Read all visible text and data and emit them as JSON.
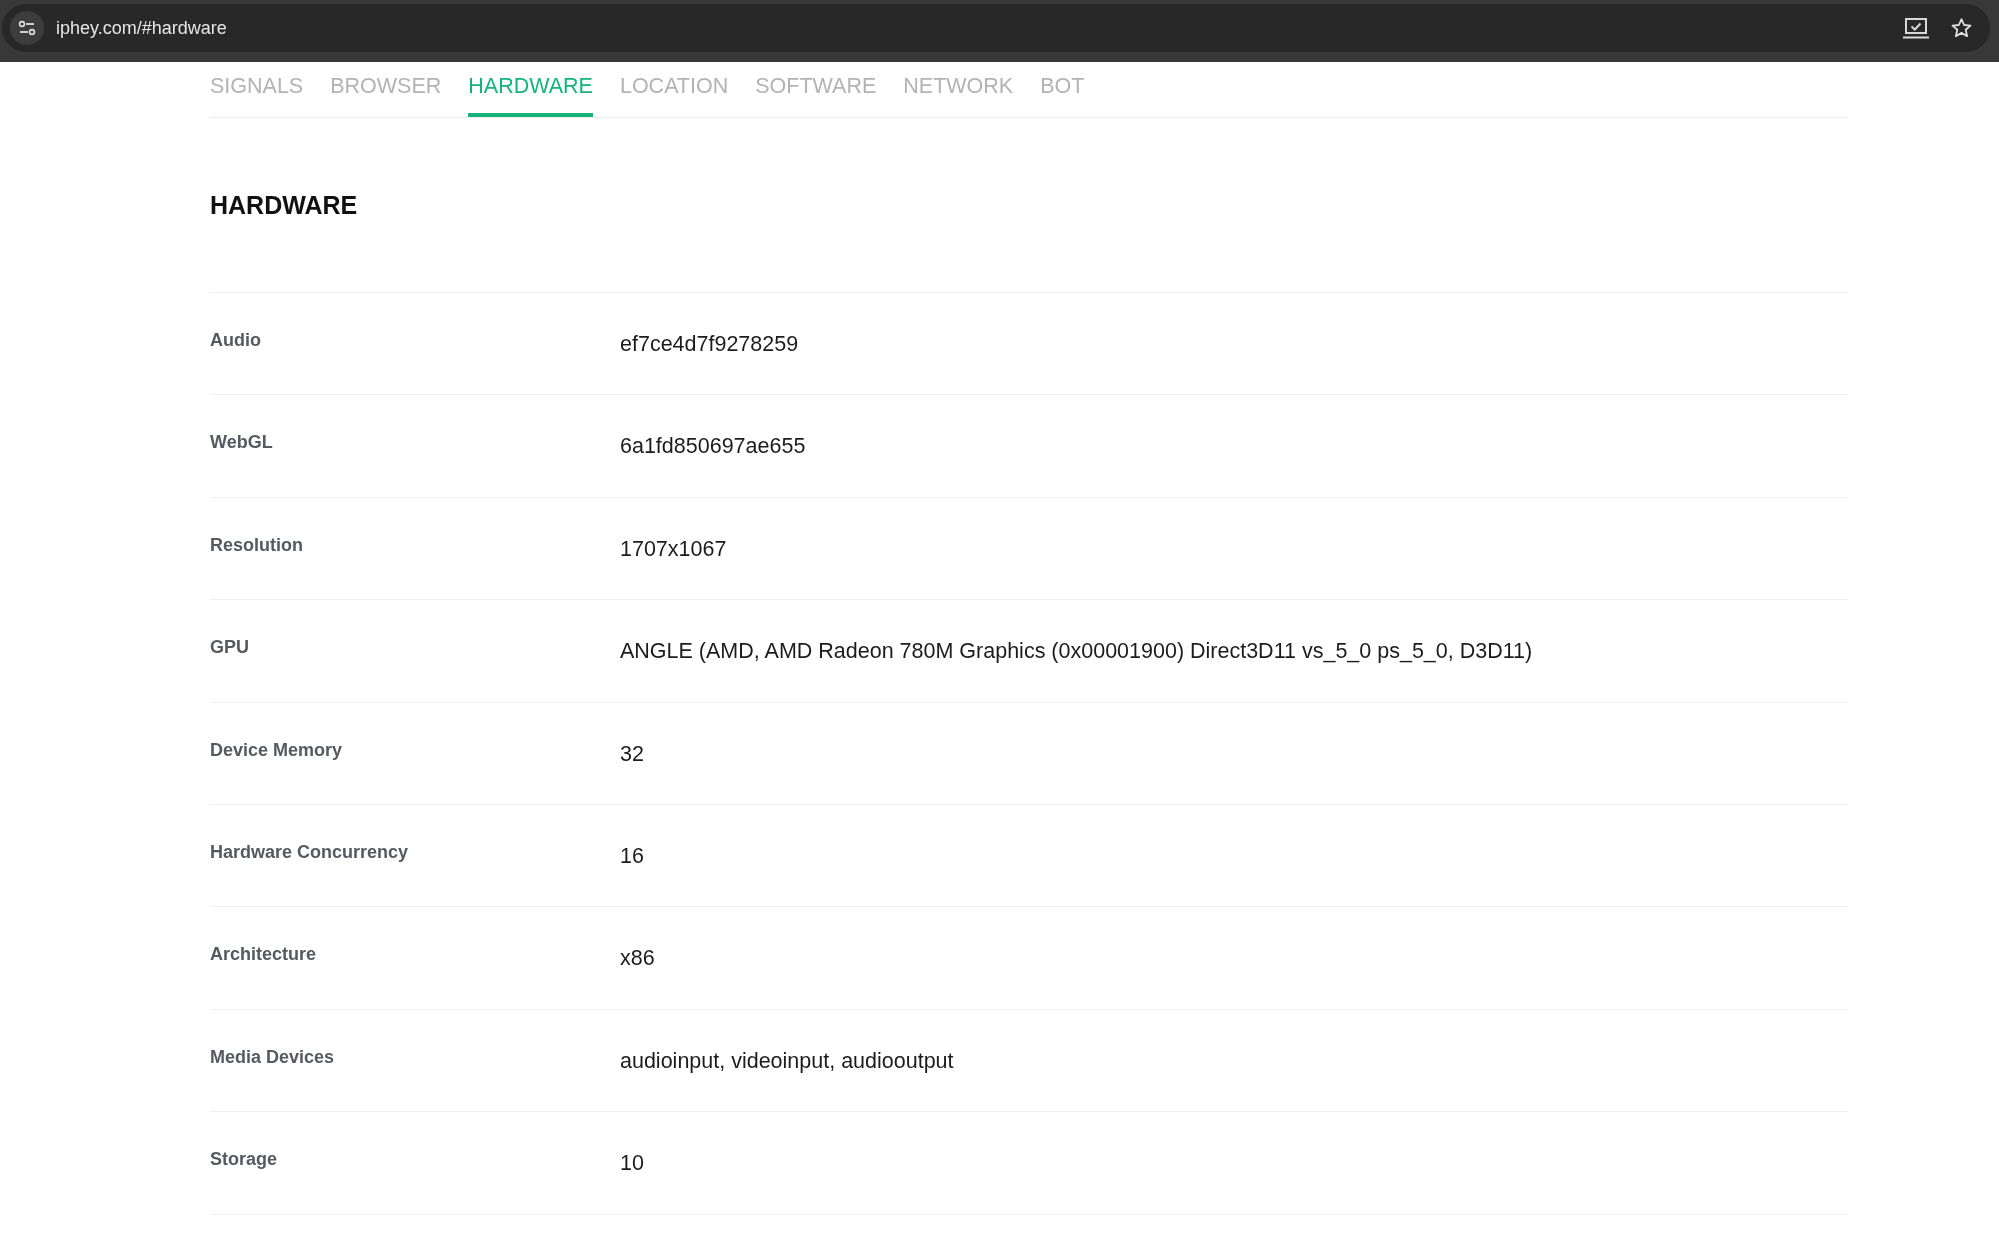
{
  "browser": {
    "url": "iphey.com/#hardware"
  },
  "tabs": [
    {
      "label": "SIGNALS",
      "selected": false
    },
    {
      "label": "BROWSER",
      "selected": false
    },
    {
      "label": "HARDWARE",
      "selected": true
    },
    {
      "label": "LOCATION",
      "selected": false
    },
    {
      "label": "SOFTWARE",
      "selected": false
    },
    {
      "label": "NETWORK",
      "selected": false
    },
    {
      "label": "BOT",
      "selected": false
    }
  ],
  "section": {
    "title": "HARDWARE",
    "rows": [
      {
        "label": "Audio",
        "value": "ef7ce4d7f9278259"
      },
      {
        "label": "WebGL",
        "value": "6a1fd850697ae655"
      },
      {
        "label": "Resolution",
        "value": "1707x1067"
      },
      {
        "label": "GPU",
        "value": "ANGLE (AMD, AMD Radeon 780M Graphics (0x00001900) Direct3D11 vs_5_0 ps_5_0, D3D11)"
      },
      {
        "label": "Device Memory",
        "value": "32"
      },
      {
        "label": "Hardware Concurrency",
        "value": "16"
      },
      {
        "label": "Architecture",
        "value": "x86"
      },
      {
        "label": "Media Devices",
        "value": "audioinput, videoinput, audiooutput"
      },
      {
        "label": "Storage",
        "value": "10"
      }
    ]
  }
}
